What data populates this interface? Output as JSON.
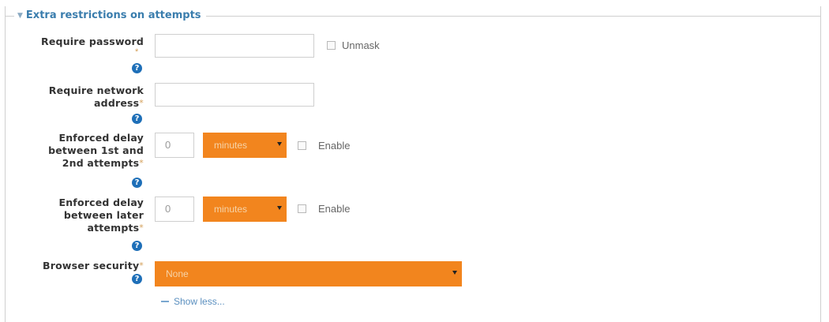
{
  "section": {
    "legend": "Extra restrictions on attempts",
    "collapse_icon": "triangle-down-icon"
  },
  "required_marker": "*",
  "help_icon_glyph": "?",
  "fields": {
    "password": {
      "label": "Require password",
      "value": "",
      "unmask_label": "Unmask"
    },
    "network": {
      "label_line1": "Require network",
      "label_line2": "address",
      "value": ""
    },
    "delay1": {
      "label_line1": "Enforced delay",
      "label_line2": "between 1st and",
      "label_line3": "2nd attempts",
      "value": "0",
      "unit": "minutes",
      "enable_label": "Enable"
    },
    "delay2": {
      "label_line1": "Enforced delay",
      "label_line2": "between later",
      "label_line3": "attempts",
      "value": "0",
      "unit": "minutes",
      "enable_label": "Enable"
    },
    "browser_security": {
      "label": "Browser security",
      "value": "None"
    }
  },
  "show_less_label": "Show less...",
  "colors": {
    "accent_orange": "#f2851e",
    "legend_blue": "#3a7dad",
    "help_blue": "#1e6fb8",
    "required_marker": "#d4a05a"
  }
}
